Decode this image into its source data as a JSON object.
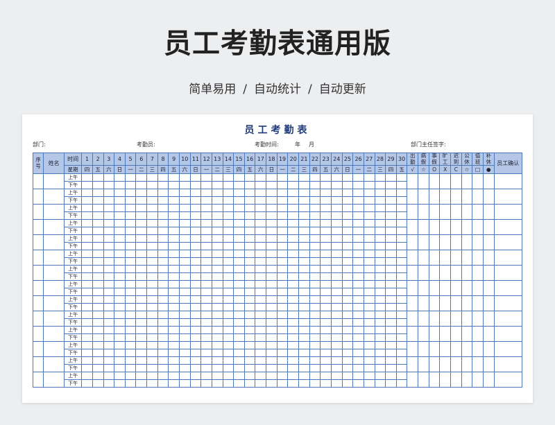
{
  "page": {
    "title": "员工考勤表通用版",
    "subtitle_parts": [
      "简单易用",
      "自动统计",
      "自动更新"
    ],
    "separator": "/"
  },
  "sheet": {
    "title": "员工考勤表",
    "info": {
      "department": "部门:",
      "clerk": "考勤员:",
      "period": "考勤时间:",
      "year": "年",
      "month": "月",
      "manager_sign": "部门主任签字:"
    },
    "headers": {
      "seq": "序号",
      "name": "姓名",
      "time": "时间",
      "weekday": "星期",
      "confirm": "员工确认"
    },
    "days": [
      "1",
      "2",
      "3",
      "4",
      "5",
      "6",
      "7",
      "8",
      "9",
      "10",
      "11",
      "12",
      "13",
      "14",
      "15",
      "16",
      "17",
      "18",
      "19",
      "20",
      "21",
      "22",
      "23",
      "24",
      "25",
      "26",
      "27",
      "28",
      "29",
      "30"
    ],
    "weekdays": [
      "四",
      "五",
      "六",
      "日",
      "一",
      "二",
      "三",
      "四",
      "五",
      "六",
      "日",
      "一",
      "二",
      "三",
      "四",
      "五",
      "六",
      "日",
      "一",
      "二",
      "三",
      "四",
      "五",
      "六",
      "日",
      "一",
      "二",
      "三",
      "四",
      "五"
    ],
    "summary": [
      {
        "label": "出勤",
        "symbol": "√"
      },
      {
        "label": "病假",
        "symbol": "☆"
      },
      {
        "label": "事假",
        "symbol": "O"
      },
      {
        "label": "旷工",
        "symbol": "X"
      },
      {
        "label": "迟到",
        "symbol": "C"
      },
      {
        "label": "公休",
        "symbol": "☆"
      },
      {
        "label": "值班",
        "symbol": "□"
      },
      {
        "label": "补休",
        "symbol": "●"
      }
    ],
    "am": "上午",
    "pm": "下午",
    "employee_rows": 14
  },
  "colors": {
    "header_bg": "#b4c7e7",
    "border": "#4a78b8",
    "sheet_title": "#1e3a78"
  }
}
